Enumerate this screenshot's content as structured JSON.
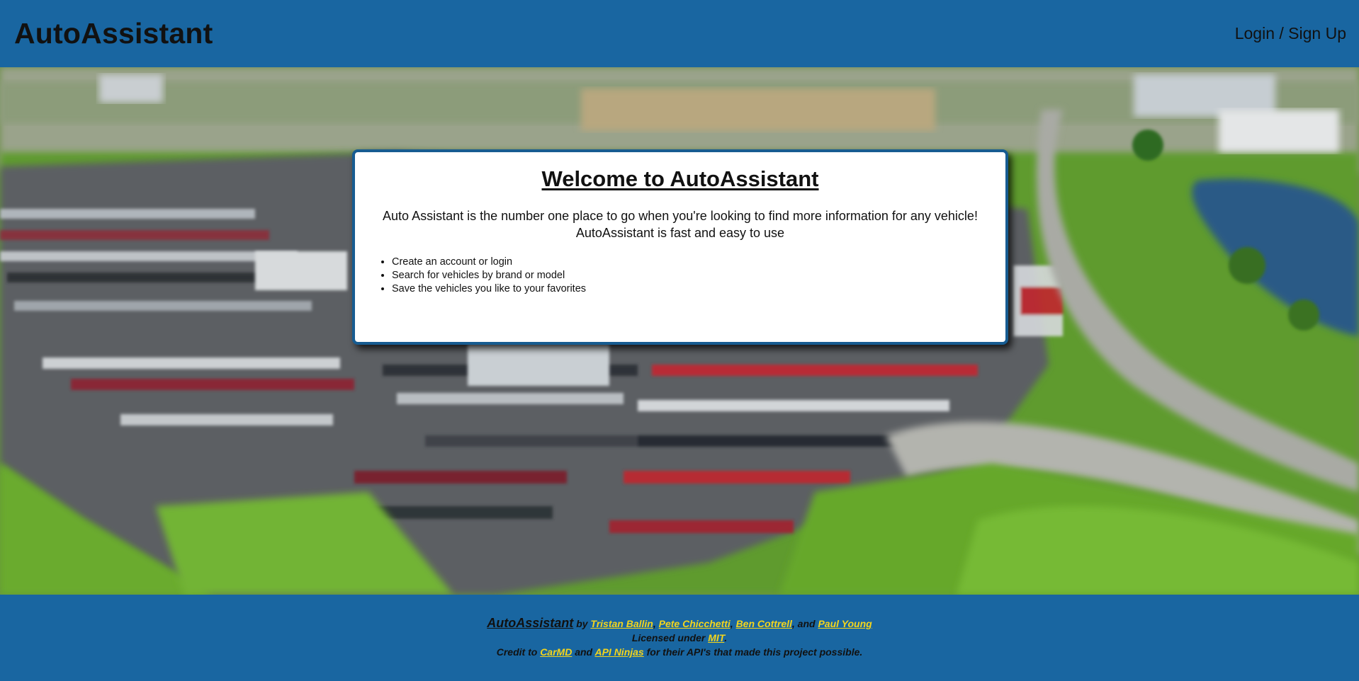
{
  "header": {
    "brand": "AutoAssistant",
    "login_label": "Login / Sign Up"
  },
  "hero": {
    "background_image": "blurred aerial view of car dealership parking lot"
  },
  "card": {
    "title": "Welcome to AutoAssistant",
    "intro_line1": "Auto Assistant is the number one place to go when you're looking to find more information for any vehicle!",
    "intro_line2": "AutoAssistant is fast and easy to use",
    "features": [
      "Create an account or login",
      "Search for vehicles by brand or model",
      "Save the vehicles you like to your favorites"
    ]
  },
  "footer": {
    "brand": "AutoAssistant",
    "by_text": "by",
    "authors": [
      "Tristan Ballin",
      "Pete Chicchetti",
      "Ben Cottrell",
      "Paul Young"
    ],
    "sep1": ",",
    "sep2": ",",
    "sep3": ", and",
    "license_prefix": "Licensed under",
    "license_link": "MIT",
    "license_suffix": ".",
    "credit_prefix": "Credit to",
    "credit_link1": "CarMD",
    "credit_and": "and",
    "credit_link2": "API Ninjas",
    "credit_suffix": "for their API's that made this project possible."
  },
  "colors": {
    "bar": "#1966a1",
    "link": "#f4d51c",
    "card_border": "#175c91"
  }
}
